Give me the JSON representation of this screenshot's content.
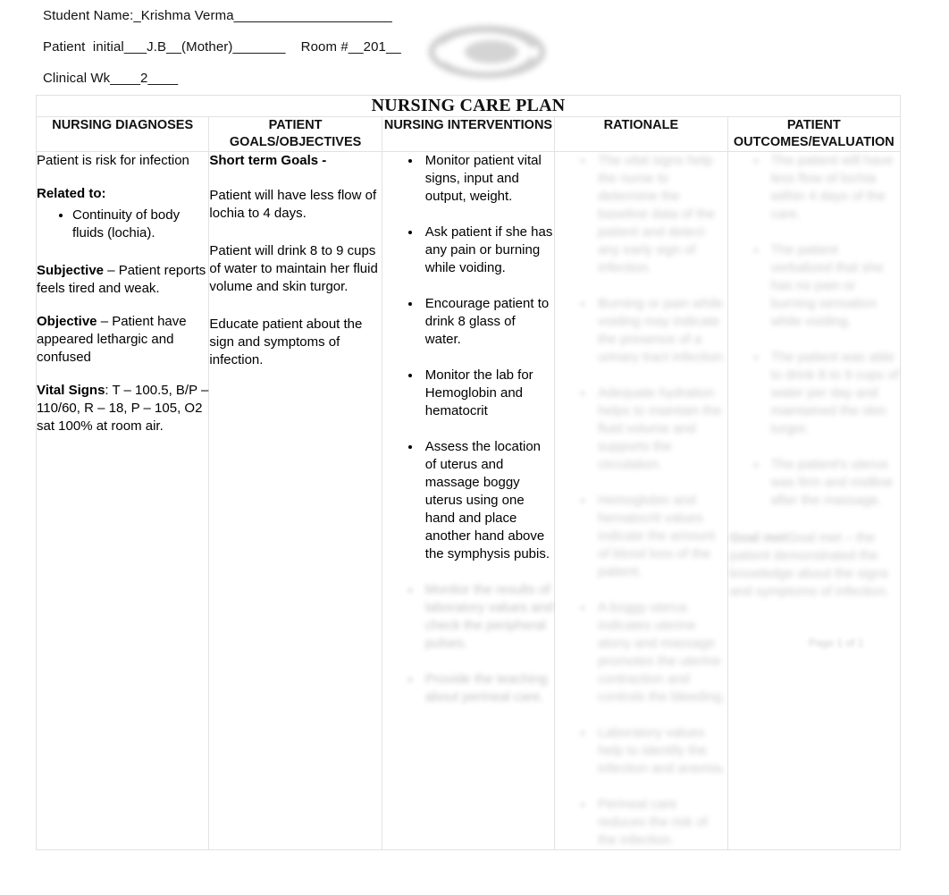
{
  "header": {
    "student_name_line": "Student Name:_Krishma Verma_____________________",
    "patient_line": "Patient  initial___J.B__(Mother)_______    Room #__201__",
    "clinical_week_line": "Clinical Wk____2____",
    "logo_alt": "school-logo-watermark"
  },
  "table": {
    "title": "NURSING CARE PLAN",
    "columns": [
      "NURSING DIAGNOSES",
      "PATIENT GOALS/OBJECTIVES",
      "NURSING INTERVENTIONS",
      "RATIONALE",
      "PATIENT OUTCOMES/EVALUATION"
    ],
    "nursing_diagnoses": {
      "statement": "Patient is risk for infection",
      "related_to_label": "Related to:",
      "related_to_items": [
        "Continuity of body fluids (lochia)."
      ],
      "subjective_label": "Subjective",
      "subjective_text": " – Patient reports feels tired and weak.",
      "objective_label": "Objective",
      "objective_text": " – Patient have appeared lethargic and confused",
      "vital_signs_label": "Vital Signs",
      "vital_signs_text": ": T – 100.5, B/P – 110/60, R – 18, P – 105, O2 sat 100% at room air."
    },
    "patient_goals": {
      "short_term_label": "Short term Goals -",
      "goals": [
        "Patient will have less flow of lochia to 4 days.",
        "Patient will drink 8 to 9 cups of water to maintain her fluid volume and skin turgor.",
        "Educate patient about the sign and symptoms of infection."
      ]
    },
    "nursing_interventions": {
      "items": [
        "Monitor patient vital signs, input and output, weight.",
        "Ask patient if she has any pain or burning while voiding.",
        "Encourage patient to drink 8 glass of water.",
        "Monitor the lab for Hemoglobin and hematocrit",
        "Assess the location of uterus and massage boggy uterus using one hand and place another hand above the symphysis pubis."
      ],
      "obscured_items": [
        "Monitor the results of laboratory values and check the peripheral pulses.",
        "Provide the teaching about perineal care."
      ]
    },
    "rationale": {
      "obscured": true,
      "obscured_items": [
        "The vital signs help the nurse to determine the baseline data of the patient and detect any early sign of infection.",
        "Burning or pain while voiding may indicate the presence of a urinary tract infection.",
        "Adequate hydration helps to maintain the fluid volume and supports the circulation.",
        "Hemoglobin and hematocrit values indicate the amount of blood loss of the patient.",
        "A boggy uterus indicates uterine atony and massage promotes the uterine contraction and controls the bleeding.",
        "Laboratory values help to identify the infection and anemia.",
        "Perineal care reduces the risk of the infection."
      ]
    },
    "patient_outcomes": {
      "obscured": true,
      "obscured_items": [
        "The patient will have less flow of lochia within 4 days of the care.",
        "The patient verbalized that she has no pain or burning sensation while voiding.",
        "The patient was able to drink 8 to 9 cups of water per day and maintained the skin turgor.",
        "The patient's uterus was firm and midline after the massage.",
        "Goal met – the patient demonstrated the knowledge about the signs and symptoms of infection."
      ],
      "goal_status_label": "Goal met"
    }
  },
  "footer": {
    "watermark": "Page 1 of 1"
  }
}
